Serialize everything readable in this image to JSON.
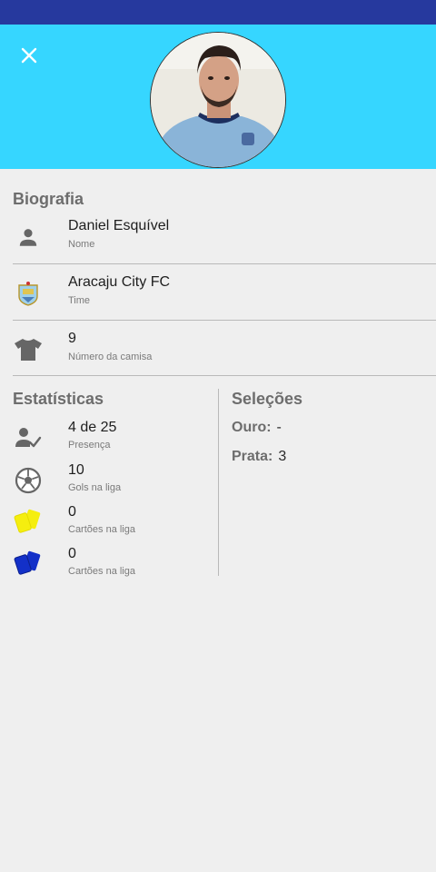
{
  "biography": {
    "title": "Biografia",
    "name": {
      "value": "Daniel Esquível",
      "label": "Nome",
      "icon": "person-icon"
    },
    "team": {
      "value": "Aracaju City FC",
      "label": "Time",
      "icon": "team-crest-icon"
    },
    "shirt": {
      "value": "9",
      "label": "Número da camisa",
      "icon": "shirt-icon"
    }
  },
  "statistics": {
    "title": "Estatísticas",
    "items": [
      {
        "value": "4 de 25",
        "label": "Presença",
        "icon": "attendance-icon"
      },
      {
        "value": "10",
        "label": "Gols na liga",
        "icon": "soccer-ball-icon"
      },
      {
        "value": "0",
        "label": "Cartões na liga",
        "icon": "yellow-cards-icon"
      },
      {
        "value": "0",
        "label": "Cartões na liga",
        "icon": "blue-cards-icon"
      }
    ]
  },
  "selections": {
    "title": "Seleções",
    "items": [
      {
        "label": "Ouro:",
        "value": "-"
      },
      {
        "label": "Prata:",
        "value": "3"
      }
    ]
  },
  "colors": {
    "status_bar": "#26399e",
    "header": "#36d6ff",
    "background": "#efefef",
    "yellow_card": "#f5ee0f",
    "blue_card": "#1330c8"
  }
}
